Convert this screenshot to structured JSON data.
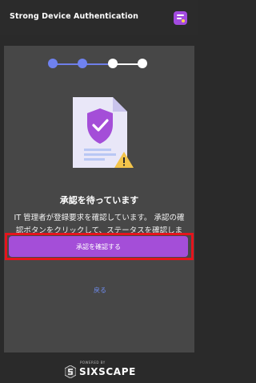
{
  "header": {
    "title": "Strong Device Authentication",
    "icon": "app-icon"
  },
  "stepper": {
    "total": 4,
    "completed": 2,
    "colors": {
      "done": "#6f82f0",
      "todo": "#ffffff"
    }
  },
  "main": {
    "heading": "承認を待っています",
    "description": "IT 管理者が登録要求を確認しています。 承認の確認ボタンをクリックして、ステータスを確認します。",
    "confirm_button": "承認を確認する",
    "back_link": "戻る"
  },
  "footer": {
    "powered_by": "POWERED BY",
    "brand": "SIXSCAPE"
  },
  "colors": {
    "accent": "#a44ed8",
    "highlight": "#e5141c",
    "link": "#6f8cf0"
  }
}
